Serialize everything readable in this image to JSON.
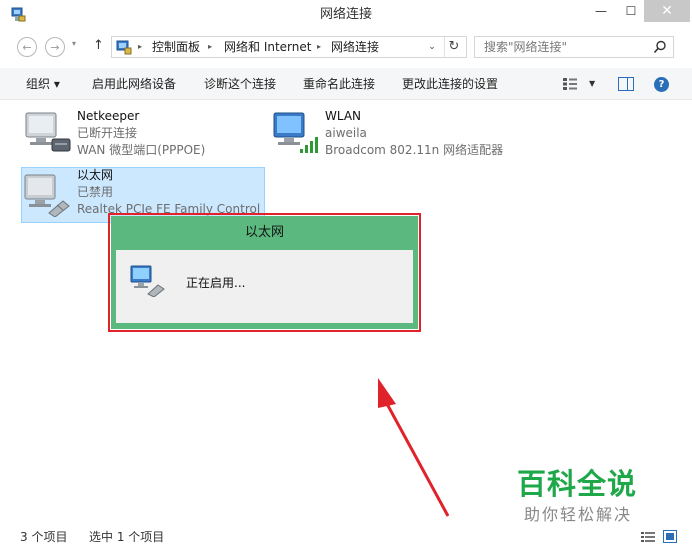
{
  "window": {
    "title": "网络连接",
    "minimize_symbol": "—",
    "maximize_symbol": "☐",
    "close_symbol": "✕"
  },
  "address": {
    "back_symbol": "←",
    "forward_symbol": "→",
    "recent_symbol": "▾",
    "up_symbol": "↑",
    "separator": "▸",
    "crumbs": [
      "控制面板",
      "网络和 Internet",
      "网络连接"
    ],
    "dropdown_symbol": "⌄",
    "refresh_symbol": "↻",
    "search_placeholder": "搜索\"网络连接\""
  },
  "toolbar": {
    "organize": "组织 ▾",
    "enable": "启用此网络设备",
    "diagnose": "诊断这个连接",
    "rename": "重命名此连接",
    "change": "更改此连接的设置",
    "view_dropdown": "▼",
    "help": "?"
  },
  "connections": [
    {
      "name": "Netkeeper",
      "status": "已断开连接",
      "device": "WAN 微型端口(PPPOE)"
    },
    {
      "name": "WLAN",
      "status": "aiweila",
      "device": "Broadcom 802.11n 网络适配器"
    },
    {
      "name": "以太网",
      "status": "已禁用",
      "device": "Realtek PCIe FE Family Control"
    }
  ],
  "dialog": {
    "title": "以太网",
    "message": "正在启用..."
  },
  "statusbar": {
    "count": "3 个项目",
    "selected": "选中 1 个项目"
  },
  "watermark": {
    "title": "百科全说",
    "subtitle": "助你轻松解决"
  },
  "colors": {
    "selection": "#cce8ff",
    "dialog_green": "#5bb97f",
    "highlight_red": "#e0222b",
    "watermark_green": "#1fa84a"
  }
}
